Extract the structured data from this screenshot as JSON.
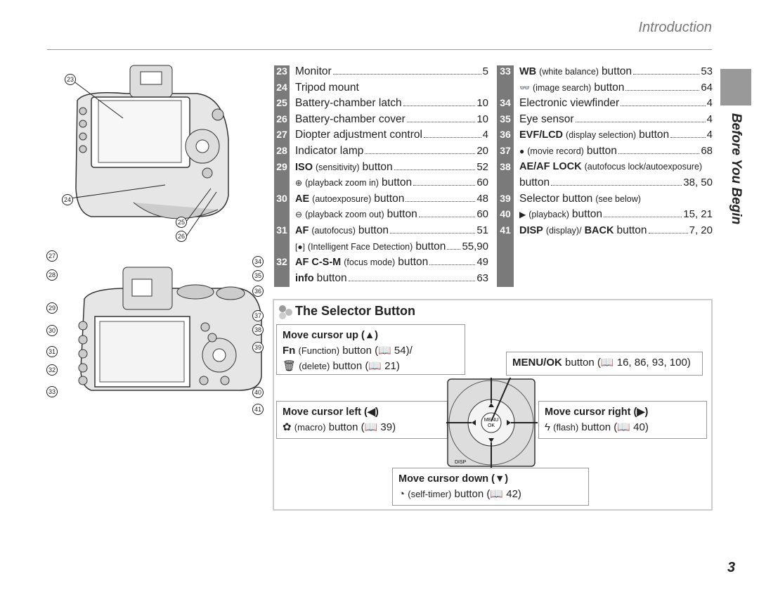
{
  "header": {
    "section": "Introduction",
    "side_tab": "Before You Begin",
    "page_number": "3"
  },
  "callouts_top": [
    "23",
    "24",
    "25",
    "26"
  ],
  "callouts_bottom": [
    "27",
    "28",
    "29",
    "30",
    "31",
    "32",
    "33",
    "34",
    "35",
    "36",
    "37",
    "38",
    "39",
    "40",
    "41"
  ],
  "list_left": [
    {
      "num": "23",
      "text": "Monitor",
      "page": "5"
    },
    {
      "num": "24",
      "text": "Tripod mount",
      "page": ""
    },
    {
      "num": "25",
      "text": "Battery-chamber latch",
      "page": "10"
    },
    {
      "num": "26",
      "text": "Battery-chamber cover",
      "page": "10"
    },
    {
      "num": "27",
      "text": "Diopter adjustment control",
      "page": "4"
    },
    {
      "num": "28",
      "text": "Indicator lamp",
      "page": "20"
    },
    {
      "num": "29",
      "bold": "ISO",
      "paren": "(sensitivity)",
      "text": "button",
      "page": "52"
    },
    {
      "num": "",
      "icon": "zoom-in-icon",
      "glyph": "⊕",
      "paren": "(playback zoom in)",
      "text": "button",
      "page": "60"
    },
    {
      "num": "30",
      "bold": "AE",
      "paren": "(autoexposure)",
      "text": "button",
      "page": "48"
    },
    {
      "num": "",
      "icon": "zoom-out-icon",
      "glyph": "⊖",
      "paren": "(playback zoom out)",
      "text": "button",
      "page": "60"
    },
    {
      "num": "31",
      "bold": "AF",
      "paren": "(autofocus)",
      "text": "button",
      "page": "51"
    },
    {
      "num": "",
      "icon": "face-detection-icon",
      "glyph": "[●]",
      "paren": "(Intelligent Face Detection)",
      "text": "button",
      "page": "55,90"
    },
    {
      "num": "32",
      "bold": "AF C-S-M",
      "paren": "(focus mode)",
      "text": "button",
      "page": "49"
    },
    {
      "num": "",
      "bold": "info",
      "text": "button",
      "page": "63"
    }
  ],
  "list_right": [
    {
      "num": "33",
      "bold": "WB",
      "paren": "(white balance)",
      "text": "button",
      "page": "53"
    },
    {
      "num": "",
      "icon": "image-search-icon",
      "glyph": "👓",
      "paren": "(image search)",
      "text": "button",
      "page": "64"
    },
    {
      "num": "34",
      "text": "Electronic viewfinder",
      "page": "4"
    },
    {
      "num": "35",
      "text": "Eye sensor",
      "page": "4"
    },
    {
      "num": "36",
      "bold": "EVF/LCD",
      "paren": "(display selection)",
      "text": "button",
      "page": "4"
    },
    {
      "num": "37",
      "icon": "movie-record-icon",
      "glyph": "●",
      "paren": "(movie record)",
      "text": "button",
      "page": "68"
    },
    {
      "num": "38",
      "bold": "AE/AF LOCK",
      "paren": "(autofocus lock/autoexposure)",
      "text": "",
      "page": "",
      "noleader": true
    },
    {
      "num": "",
      "text": "button",
      "page": "38, 50"
    },
    {
      "num": "39",
      "text": "Selector button",
      "paren_after": "(see below)",
      "page": "",
      "noleader": true
    },
    {
      "num": "40",
      "icon": "playback-icon",
      "glyph": "▶",
      "paren": "(playback)",
      "text": "button",
      "page": "15, 21"
    },
    {
      "num": "41",
      "bold": "DISP",
      "paren": "(display)/",
      "bold2": "BACK",
      "text": "button",
      "page": "7, 20"
    }
  ],
  "selector": {
    "title": "The Selector Button",
    "up": {
      "title": "Move cursor up (▲)",
      "l1_bold": "Fn",
      "l1_paren": "(Function)",
      "l1_text": "button (📖 54)/",
      "l2_icon": "🗑",
      "l2_paren": "(delete)",
      "l2_text": "button (📖 21)"
    },
    "menu": {
      "bold": "MENU/OK",
      "text": "button (📖 16, 86, 93, 100)"
    },
    "left": {
      "title": "Move cursor left (◀)",
      "icon": "✿",
      "paren": "(macro)",
      "text": "button (📖 39)"
    },
    "right": {
      "title": "Move cursor right (▶)",
      "icon": "ϟ",
      "paren": "(flash)",
      "text": "button (📖 40)"
    },
    "down": {
      "title": "Move cursor down (▼)",
      "icon": "◔",
      "paren": "(self-timer)",
      "text": "button (📖 42)"
    },
    "dial_labels": {
      "center": "MENU\nOK",
      "disp": "DISP",
      "fn": "Fn"
    }
  },
  "colors": {
    "number_bar": "#7a7a7a",
    "side_tab": "#999999",
    "header_text": "#777777"
  }
}
